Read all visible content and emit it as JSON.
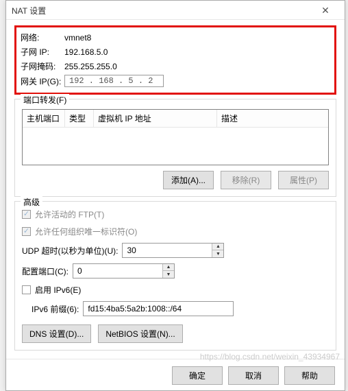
{
  "window": {
    "title": "NAT 设置",
    "close": "✕"
  },
  "network": {
    "label_network": "网络:",
    "value_network": "vmnet8",
    "label_subnet_ip": "子网 IP:",
    "value_subnet_ip": "192.168.5.0",
    "label_subnet_mask": "子网掩码:",
    "value_subnet_mask": "255.255.255.0",
    "label_gateway": "网关 IP(G):",
    "value_gateway": "192 . 168  .  5   .  2"
  },
  "port_forward": {
    "title": "端口转发(F)",
    "cols": {
      "host_port": "主机端口",
      "type": "类型",
      "vm_ip": "虚拟机 IP 地址",
      "desc": "描述"
    },
    "btn_add": "添加(A)...",
    "btn_remove": "移除(R)",
    "btn_props": "属性(P)"
  },
  "advanced": {
    "title": "高级",
    "allow_ftp": "允许活动的 FTP(T)",
    "allow_oui": "允许任何组织唯一标识符(O)",
    "udp_timeout_label": "UDP 超时(以秒为单位)(U):",
    "udp_timeout_value": "30",
    "config_port_label": "配置端口(C):",
    "config_port_value": "0",
    "enable_ipv6": "启用 IPv6(E)",
    "ipv6_prefix_label": "IPv6 前缀(6):",
    "ipv6_prefix_value": "fd15:4ba5:5a2b:1008::/64",
    "btn_dns": "DNS 设置(D)...",
    "btn_netbios": "NetBIOS 设置(N)..."
  },
  "footer": {
    "ok": "确定",
    "cancel": "取消",
    "help": "帮助"
  },
  "watermark": "https://blog.csdn.net/weixin_43934967"
}
